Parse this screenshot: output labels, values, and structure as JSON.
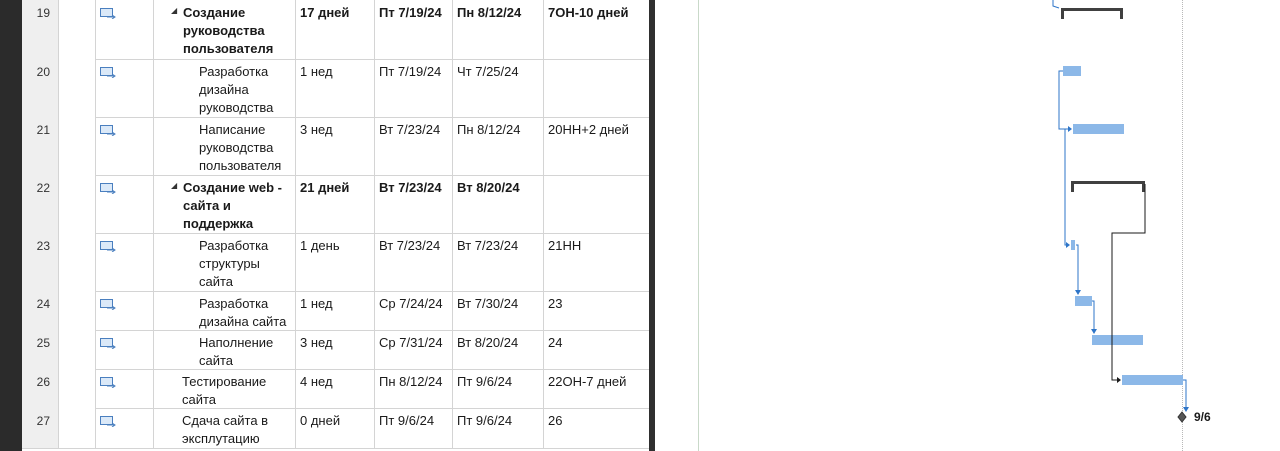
{
  "tasks": [
    {
      "id": "19",
      "name": "Создание руководства пользователя",
      "duration": "17 дней",
      "start": "Пт 7/19/24",
      "finish": "Пн 8/12/24",
      "predecessors": "7ОН-10 дней",
      "summary": true
    },
    {
      "id": "20",
      "name": "Разработка дизайна руководства",
      "duration": "1 нед",
      "start": "Пт 7/19/24",
      "finish": "Чт 7/25/24",
      "predecessors": "",
      "summary": false
    },
    {
      "id": "21",
      "name": "Написание руководства пользователя",
      "duration": "3 нед",
      "start": "Вт 7/23/24",
      "finish": "Пн 8/12/24",
      "predecessors": "20НН+2 дней",
      "summary": false
    },
    {
      "id": "22",
      "name": "Создание web - сайта и поддержка",
      "duration": "21 дней",
      "start": "Вт 7/23/24",
      "finish": "Вт 8/20/24",
      "predecessors": "",
      "summary": true
    },
    {
      "id": "23",
      "name": "Разработка структуры сайта",
      "duration": "1 день",
      "start": "Вт 7/23/24",
      "finish": "Вт 7/23/24",
      "predecessors": "21НН",
      "summary": false
    },
    {
      "id": "24",
      "name": "Разработка дизайна сайта",
      "duration": "1 нед",
      "start": "Ср 7/24/24",
      "finish": "Вт 7/30/24",
      "predecessors": "23",
      "summary": false
    },
    {
      "id": "25",
      "name": "Наполнение сайта",
      "duration": "3 нед",
      "start": "Ср 7/31/24",
      "finish": "Вт 8/20/24",
      "predecessors": "24",
      "summary": false
    },
    {
      "id": "26",
      "name": "Тестирование сайта",
      "duration": "4 нед",
      "start": "Пн 8/12/24",
      "finish": "Пт 9/6/24",
      "predecessors": "22ОН-7 дней",
      "summary": false
    },
    {
      "id": "27",
      "name": "Сдача сайта в эксплутацию",
      "duration": "0 дней",
      "start": "Пт 9/6/24",
      "finish": "Пт 9/6/24",
      "predecessors": "26",
      "summary": false
    }
  ],
  "milestone_label": "9/6",
  "colors": {
    "task_bar": "#8cb8e8",
    "summary_bar": "#404040",
    "link_blue": "#2e75c8",
    "link_black": "#1a1a1a"
  },
  "icons": {
    "task_mode": "auto-scheduled-task-icon",
    "collapse": "collapse-triangle-icon",
    "milestone": "milestone-diamond-icon"
  }
}
